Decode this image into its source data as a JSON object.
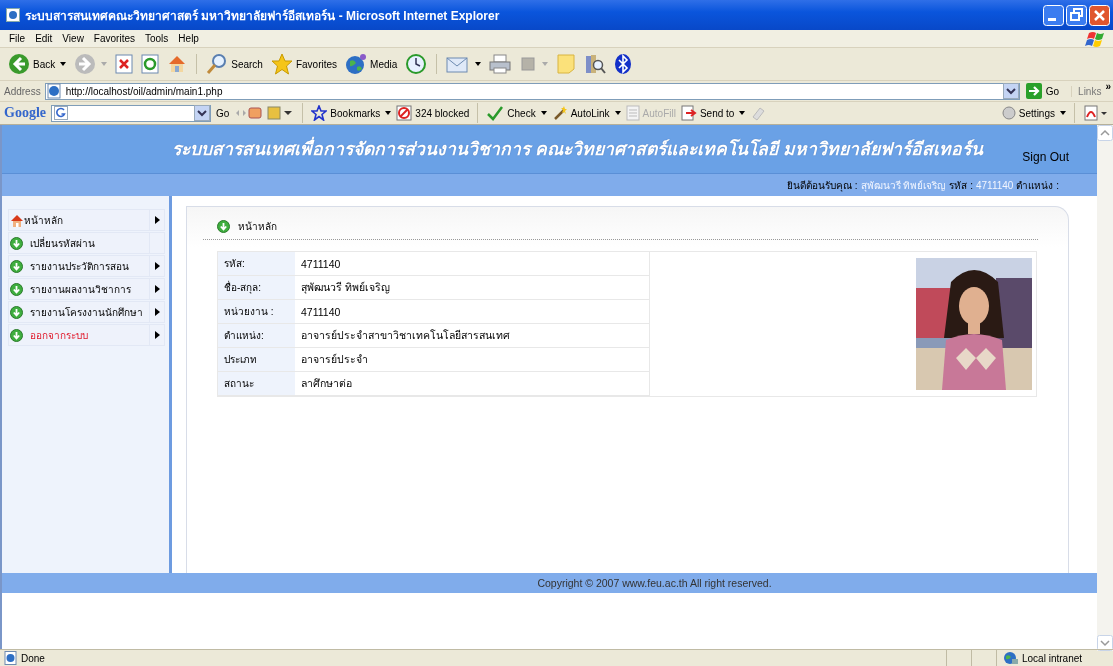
{
  "window": {
    "title": "ระบบสารสนเทศคณะวิทยาศาสตร์ มหาวิทยาลัยฟาร์อีสเทอร์น - Microsoft Internet Explorer"
  },
  "menu_bar": [
    "File",
    "Edit",
    "View",
    "Favorites",
    "Tools",
    "Help"
  ],
  "toolbar": [
    {
      "kind": "back",
      "label": "Back"
    },
    {
      "kind": "forward"
    },
    {
      "kind": "stop"
    },
    {
      "kind": "refresh"
    },
    {
      "kind": "home"
    },
    {
      "kind": "search",
      "label": "Search"
    },
    {
      "kind": "favorites",
      "label": "Favorites"
    },
    {
      "kind": "media",
      "label": "Media"
    },
    {
      "kind": "history"
    },
    {
      "kind": "mail"
    },
    {
      "kind": "print"
    },
    {
      "kind": "edit"
    },
    {
      "kind": "note"
    },
    {
      "kind": "research"
    },
    {
      "kind": "bluetooth"
    }
  ],
  "address_bar": {
    "label": "Address",
    "value": "http://localhost/oil/admin/main1.php",
    "go": "Go",
    "links": "Links",
    "more": "»"
  },
  "google_bar": {
    "logo": "Google",
    "go": "Go",
    "items": [
      {
        "kind": "bookmarks",
        "label": "Bookmarks",
        "disabled": false
      },
      {
        "kind": "blocked",
        "label": "324 blocked",
        "disabled": false
      },
      {
        "kind": "check",
        "label": "Check",
        "disabled": false
      },
      {
        "kind": "autolink",
        "label": "AutoLink",
        "disabled": false
      },
      {
        "kind": "autofill",
        "label": "AutoFill",
        "disabled": true
      },
      {
        "kind": "sendto",
        "label": "Send to",
        "disabled": false
      }
    ],
    "settings": "Settings"
  },
  "page": {
    "header": {
      "title": "ระบบสารสนเทศเพื่อการจัดการส่วนงานวิชาการ คณะวิทยาศาสตร์และเทคโนโลยี มหาวิทยาลัยฟาร์อีสเทอร์น",
      "sign_out": "Sign Out"
    },
    "welcome": {
      "label": "ยินดีต้อนรับคุณ :",
      "name": "สุพัฒนวรี ทิพย์เจริญ",
      "code_label": "รหัส :",
      "code": "4711140",
      "position_label": "ตำแหน่ง :"
    },
    "sidebar": {
      "items": [
        {
          "kind": "home",
          "label": "หน้าหลัก",
          "submenu": true
        },
        {
          "kind": "link",
          "label": "เปลี่ยนรหัสผ่าน",
          "submenu": false
        },
        {
          "kind": "link",
          "label": "รายงานประวัติการสอน",
          "submenu": true
        },
        {
          "kind": "link",
          "label": "รายงานผลงานวิชาการ",
          "submenu": true
        },
        {
          "kind": "link",
          "label": "รายงานโครงงานนักศึกษา",
          "submenu": true
        },
        {
          "kind": "logout",
          "label": "ออกจากระบบ",
          "submenu": true
        }
      ]
    },
    "content": {
      "heading": "หน้าหลัก",
      "rows": [
        {
          "label": "รหัส:",
          "value": "4711140"
        },
        {
          "label": "ชื่อ-สกุล:",
          "value": "สุพัฒนวรี ทิพย์เจริญ"
        },
        {
          "label": "หน่วยงาน :",
          "value": "4711140"
        },
        {
          "label": "ตำแหน่ง:",
          "value": "อาจารย์ประจำสาขาวิชาเทคโนโลยีสารสนเทศ"
        },
        {
          "label": "ประเภท",
          "value": "อาจารย์ประจำ"
        },
        {
          "label": "สถานะ",
          "value": "ลาศึกษาต่อ"
        }
      ]
    },
    "footer": {
      "copyright": "Copyright © 2007 www.feu.ac.th All right reserved."
    }
  },
  "status_bar": {
    "status": "Done",
    "zone": "Local intranet"
  }
}
